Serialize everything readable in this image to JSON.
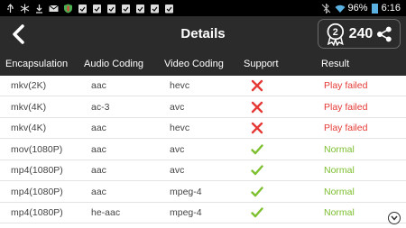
{
  "status_bar": {
    "battery_percent": "96%",
    "time": "6:16",
    "icons": [
      "usb-icon",
      "snowflake-icon",
      "download-icon",
      "mail-icon",
      "shield-icon",
      "clipboard-check-icon",
      "clipboard-check-icon",
      "clipboard-check-icon",
      "clipboard-check-icon",
      "clipboard-check-icon",
      "clipboard-check-icon",
      "clipboard-check-icon"
    ]
  },
  "header": {
    "title": "Details",
    "points": "240"
  },
  "table": {
    "columns": [
      "Encapsulation",
      "Audio Coding",
      "Video Coding",
      "Support",
      "Result"
    ],
    "rows": [
      {
        "encapsulation": "mkv(2K)",
        "audio": "aac",
        "video": "hevc",
        "support": "cross",
        "result": "Play failed"
      },
      {
        "encapsulation": "mkv(4K)",
        "audio": "ac-3",
        "video": "avc",
        "support": "cross",
        "result": "Play failed"
      },
      {
        "encapsulation": "mkv(4K)",
        "audio": "aac",
        "video": "hevc",
        "support": "cross",
        "result": "Play failed"
      },
      {
        "encapsulation": "mov(1080P)",
        "audio": "aac",
        "video": "avc",
        "support": "check",
        "result": "Normal"
      },
      {
        "encapsulation": "mp4(1080P)",
        "audio": "aac",
        "video": "avc",
        "support": "check",
        "result": "Normal"
      },
      {
        "encapsulation": "mp4(1080P)",
        "audio": "aac",
        "video": "mpeg-4",
        "support": "check",
        "result": "Normal"
      },
      {
        "encapsulation": "mp4(1080P)",
        "audio": "he-aac",
        "video": "mpeg-4",
        "support": "check",
        "result": "Normal"
      }
    ]
  },
  "colors": {
    "fail": "#e53935",
    "ok": "#7cbf2f",
    "bar": "#2b2b2b"
  }
}
